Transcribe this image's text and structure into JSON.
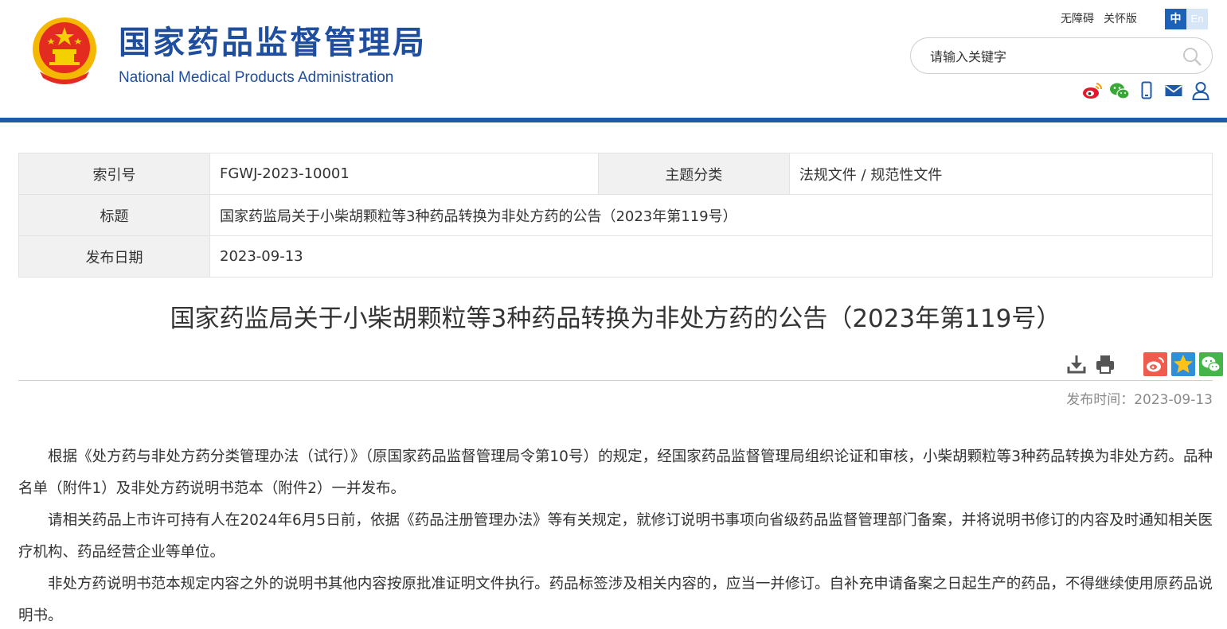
{
  "header": {
    "site_title": "国家药品监督管理局",
    "site_subtitle": "National Medical Products Administration",
    "top_links": [
      "无障碍",
      "关怀版"
    ],
    "lang_zh": "中",
    "lang_en": "En",
    "search_placeholder": "请输入关键字",
    "social_icons": [
      "weibo-icon",
      "wechat-icon",
      "mobile-icon",
      "mail-icon",
      "user-icon"
    ],
    "brand_color": "#1f5aa8"
  },
  "info": {
    "index_label": "索引号",
    "index_value": "FGWJ-2023-10001",
    "category_label": "主题分类",
    "category_value": "法规文件 / 规范性文件",
    "title_label": "标题",
    "title_value": "国家药监局关于小柴胡颗粒等3种药品转换为非处方药的公告（2023年第119号）",
    "date_label": "发布日期",
    "date_value": "2023-09-13"
  },
  "article": {
    "title": "国家药监局关于小柴胡颗粒等3种药品转换为非处方药的公告（2023年第119号）",
    "tool_icons": [
      "download-icon",
      "print-icon",
      "weibo-share-icon",
      "qzone-share-icon",
      "wechat-share-icon"
    ],
    "pubtime_label": "发布时间：",
    "pubtime_value": "2023-09-13",
    "paragraphs": [
      "根据《处方药与非处方药分类管理办法（试行）》（原国家药品监督管理局令第10号）的规定，经国家药品监督管理局组织论证和审核，小柴胡颗粒等3种药品转换为非处方药。品种名单（附件1）及非处方药说明书范本（附件2）一并发布。",
      "请相关药品上市许可持有人在2024年6月5日前，依据《药品注册管理办法》等有关规定，就修订说明书事项向省级药品监督管理部门备案，并将说明书修订的内容及时通知相关医疗机构、药品经营企业等单位。",
      "非处方药说明书范本规定内容之外的说明书其他内容按原批准证明文件执行。药品标签涉及相关内容的，应当一并修订。自补充申请备案之日起生产的药品，不得继续使用原药品说明书。"
    ]
  }
}
